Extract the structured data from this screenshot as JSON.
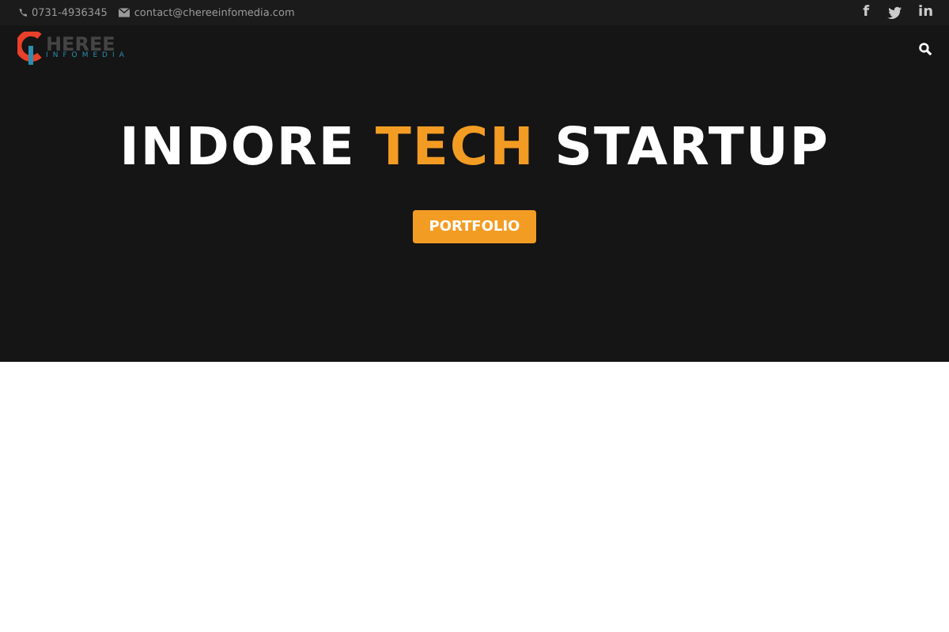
{
  "topbar": {
    "phone": "0731-4936345",
    "email": "contact@chereeinfomedia.com",
    "social": [
      "f",
      "in"
    ]
  },
  "logo": {
    "name": "HEREE",
    "tagline": "INFOMEDIA"
  },
  "hero": {
    "title_parts": [
      {
        "text": "INDORE",
        "highlight": false
      },
      {
        "text": "TECH",
        "highlight": true
      },
      {
        "text": "STARTUP",
        "highlight": false
      }
    ],
    "button": "PORTFOLIO"
  }
}
